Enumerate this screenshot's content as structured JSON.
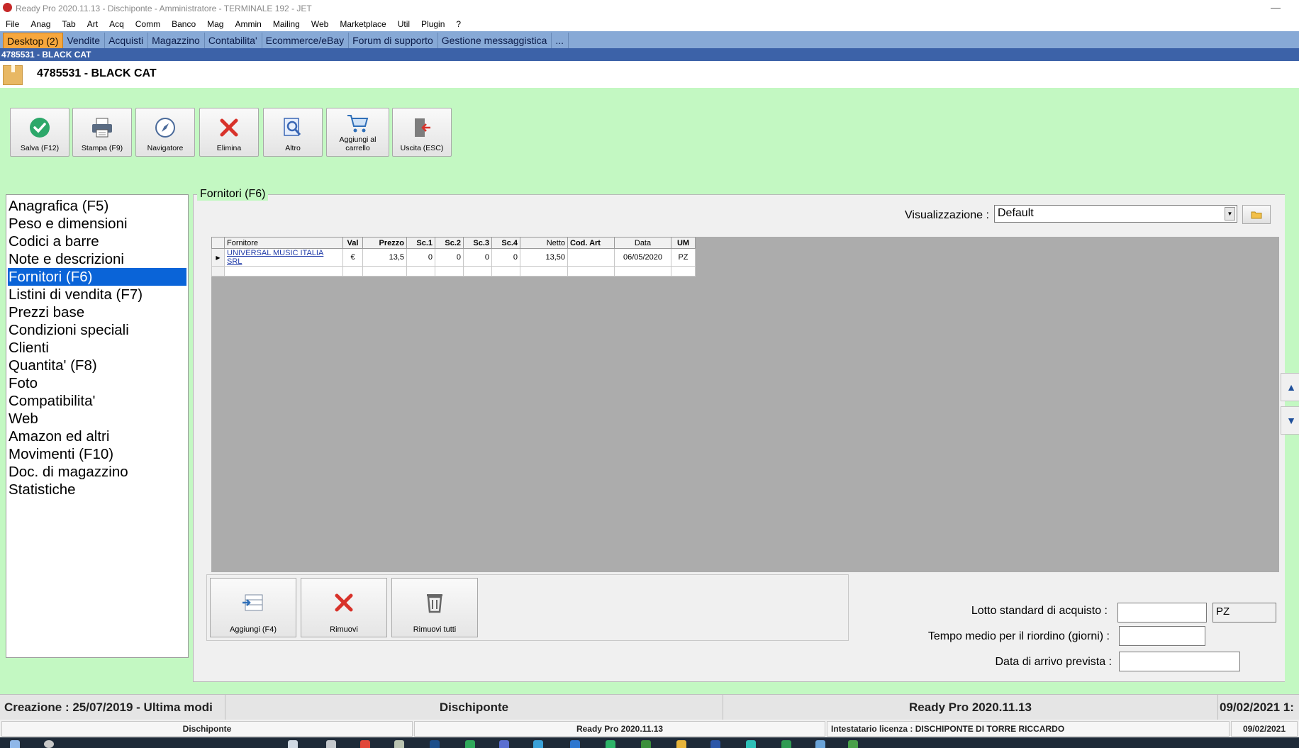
{
  "titlebar": {
    "title": "Ready Pro 2020.11.13 - Dischiponte - Amministratore - TERMINALE 192 - JET",
    "minimize": "—"
  },
  "menu": [
    "File",
    "Anag",
    "Tab",
    "Art",
    "Acq",
    "Comm",
    "Banco",
    "Mag",
    "Ammin",
    "Mailing",
    "Web",
    "Marketplace",
    "Util",
    "Plugin",
    "?"
  ],
  "tabs": [
    "Desktop (2)",
    "Vendite",
    "Acquisti",
    "Magazzino",
    "Contabilita'",
    "Ecommerce/eBay",
    "Forum di supporto",
    "Gestione messaggistica",
    "..."
  ],
  "doc": {
    "strip_title": "4785531 - BLACK CAT",
    "title": "4785531 - BLACK CAT"
  },
  "toolbar": {
    "save": "Salva (F12)",
    "print": "Stampa (F9)",
    "navigator": "Navigatore",
    "delete": "Elimina",
    "other": "Altro",
    "cart_line1": "Aggiungi al",
    "cart_line2": "carrello",
    "exit": "Uscita (ESC)"
  },
  "nav": [
    "Anagrafica (F5)",
    "Peso e dimensioni",
    "Codici a barre",
    "Note e descrizioni",
    "Fornitori (F6)",
    "Listini di vendita (F7)",
    "Prezzi base",
    "Condizioni speciali",
    "Clienti",
    "Quantita' (F8)",
    "Foto",
    "Compatibilita'",
    "Web",
    "Amazon ed altri",
    "Movimenti (F10)",
    "Doc. di magazzino",
    "Statistiche"
  ],
  "nav_active": 4,
  "panel": {
    "title": "Fornitori (F6)",
    "view_label": "Visualizzazione :",
    "view_value": "Default"
  },
  "grid": {
    "headers": [
      "Fornitore",
      "Val",
      "Prezzo",
      "Sc.1",
      "Sc.2",
      "Sc.3",
      "Sc.4",
      "Netto",
      "Cod. Art",
      "Data",
      "UM"
    ],
    "rows": [
      [
        "UNIVERSAL MUSIC ITALIA SRL",
        "€",
        "13,5",
        "0",
        "0",
        "0",
        "0",
        "13,50",
        "",
        "06/05/2020",
        "PZ"
      ]
    ]
  },
  "actions": {
    "add": "Aggiungi (F4)",
    "remove": "Rimuovi",
    "remove_all": "Rimuovi tutti"
  },
  "fields": {
    "lot_label": "Lotto standard di acquisto :",
    "lot_value": "",
    "lot_unit": "PZ",
    "reorder_label": "Tempo medio per il riordino (giorni) :",
    "reorder_value": "",
    "arrival_label": "Data di arrivo prevista :",
    "arrival_value": ""
  },
  "status": {
    "created": "Creazione : 25/07/2019 - Ultima modi",
    "company": "Dischiponte",
    "version": "Ready Pro 2020.11.13",
    "date": "09/02/2021 1:"
  },
  "status2": {
    "company": "Dischiponte",
    "version": "Ready Pro 2020.11.13",
    "license": "Intestatario licenza : DISCHIPONTE DI TORRE RICCARDO",
    "date": "09/02/2021"
  },
  "colors": {
    "green_bg": "#c3f8c2",
    "tab_active": "#f7a73d",
    "nav_active": "#0a64d8",
    "tab_strip": "#87a9d6",
    "grid_bg": "#acacac"
  }
}
